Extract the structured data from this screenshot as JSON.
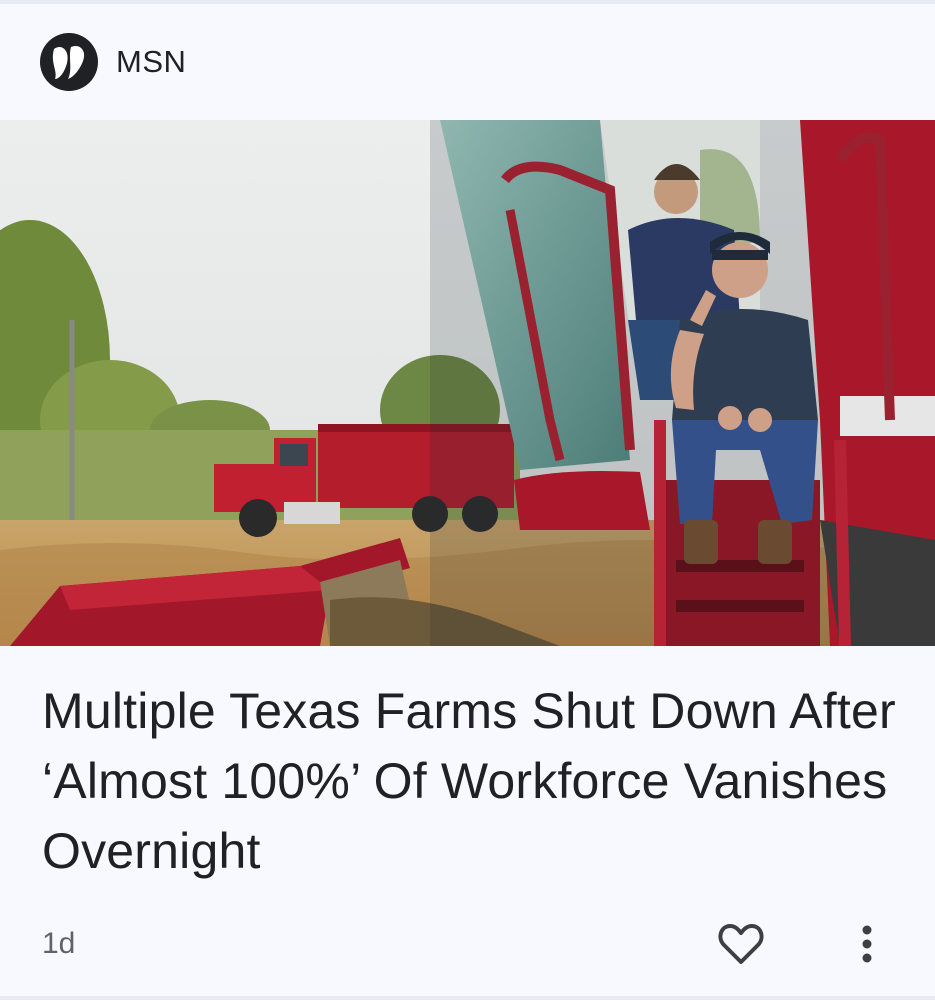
{
  "source": {
    "name": "MSN",
    "logo_icon": "msn-butterfly-logo"
  },
  "article": {
    "image_alt": "Two farmers sitting on the steps of a red combine harvester in a harvested corn field, with a red dump truck in the background",
    "headline": "Multiple Texas Farms Shut Down After ‘Almost 100%’ Of Workforce Vanishes Overnight",
    "age": "1d"
  },
  "actions": {
    "like_icon": "heart-outline-icon",
    "more_icon": "more-vertical-icon"
  },
  "colors": {
    "background": "#f8f9fe",
    "text": "#202124",
    "secondary_text": "#5f6368",
    "harvester_red": "#a8182a"
  }
}
